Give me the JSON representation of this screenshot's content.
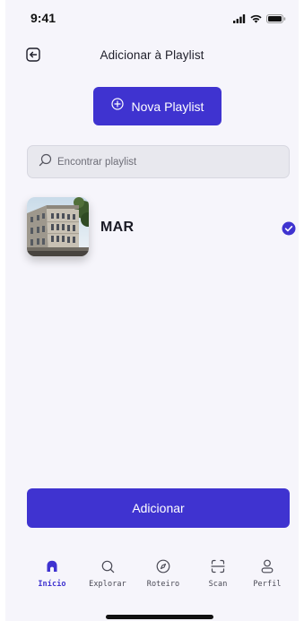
{
  "status_bar": {
    "time": "9:41",
    "icons": [
      "signal-icon",
      "wifi-icon",
      "battery-icon"
    ]
  },
  "header": {
    "back_icon": "back-arrow-icon",
    "title": "Adicionar à Playlist"
  },
  "new_playlist": {
    "icon": "plus-circle-icon",
    "label": "Nova Playlist"
  },
  "search": {
    "icon": "search-icon",
    "placeholder": "Encontrar playlist",
    "value": ""
  },
  "playlists": [
    {
      "name": "MAR",
      "thumbnail": "building-photo",
      "selected": true
    }
  ],
  "add_button": {
    "label": "Adicionar"
  },
  "bottom_nav": {
    "items": [
      {
        "label": "Início",
        "icon": "home-icon",
        "active": true
      },
      {
        "label": "Explorar",
        "icon": "search-icon",
        "active": false
      },
      {
        "label": "Roteiro",
        "icon": "compass-icon",
        "active": false
      },
      {
        "label": "Scan",
        "icon": "scan-icon",
        "active": false
      },
      {
        "label": "Perfil",
        "icon": "user-icon",
        "active": false
      }
    ]
  },
  "colors": {
    "accent": "#3f33d0",
    "background": "#f6f5fb",
    "search_bg": "#e8e8ee"
  }
}
